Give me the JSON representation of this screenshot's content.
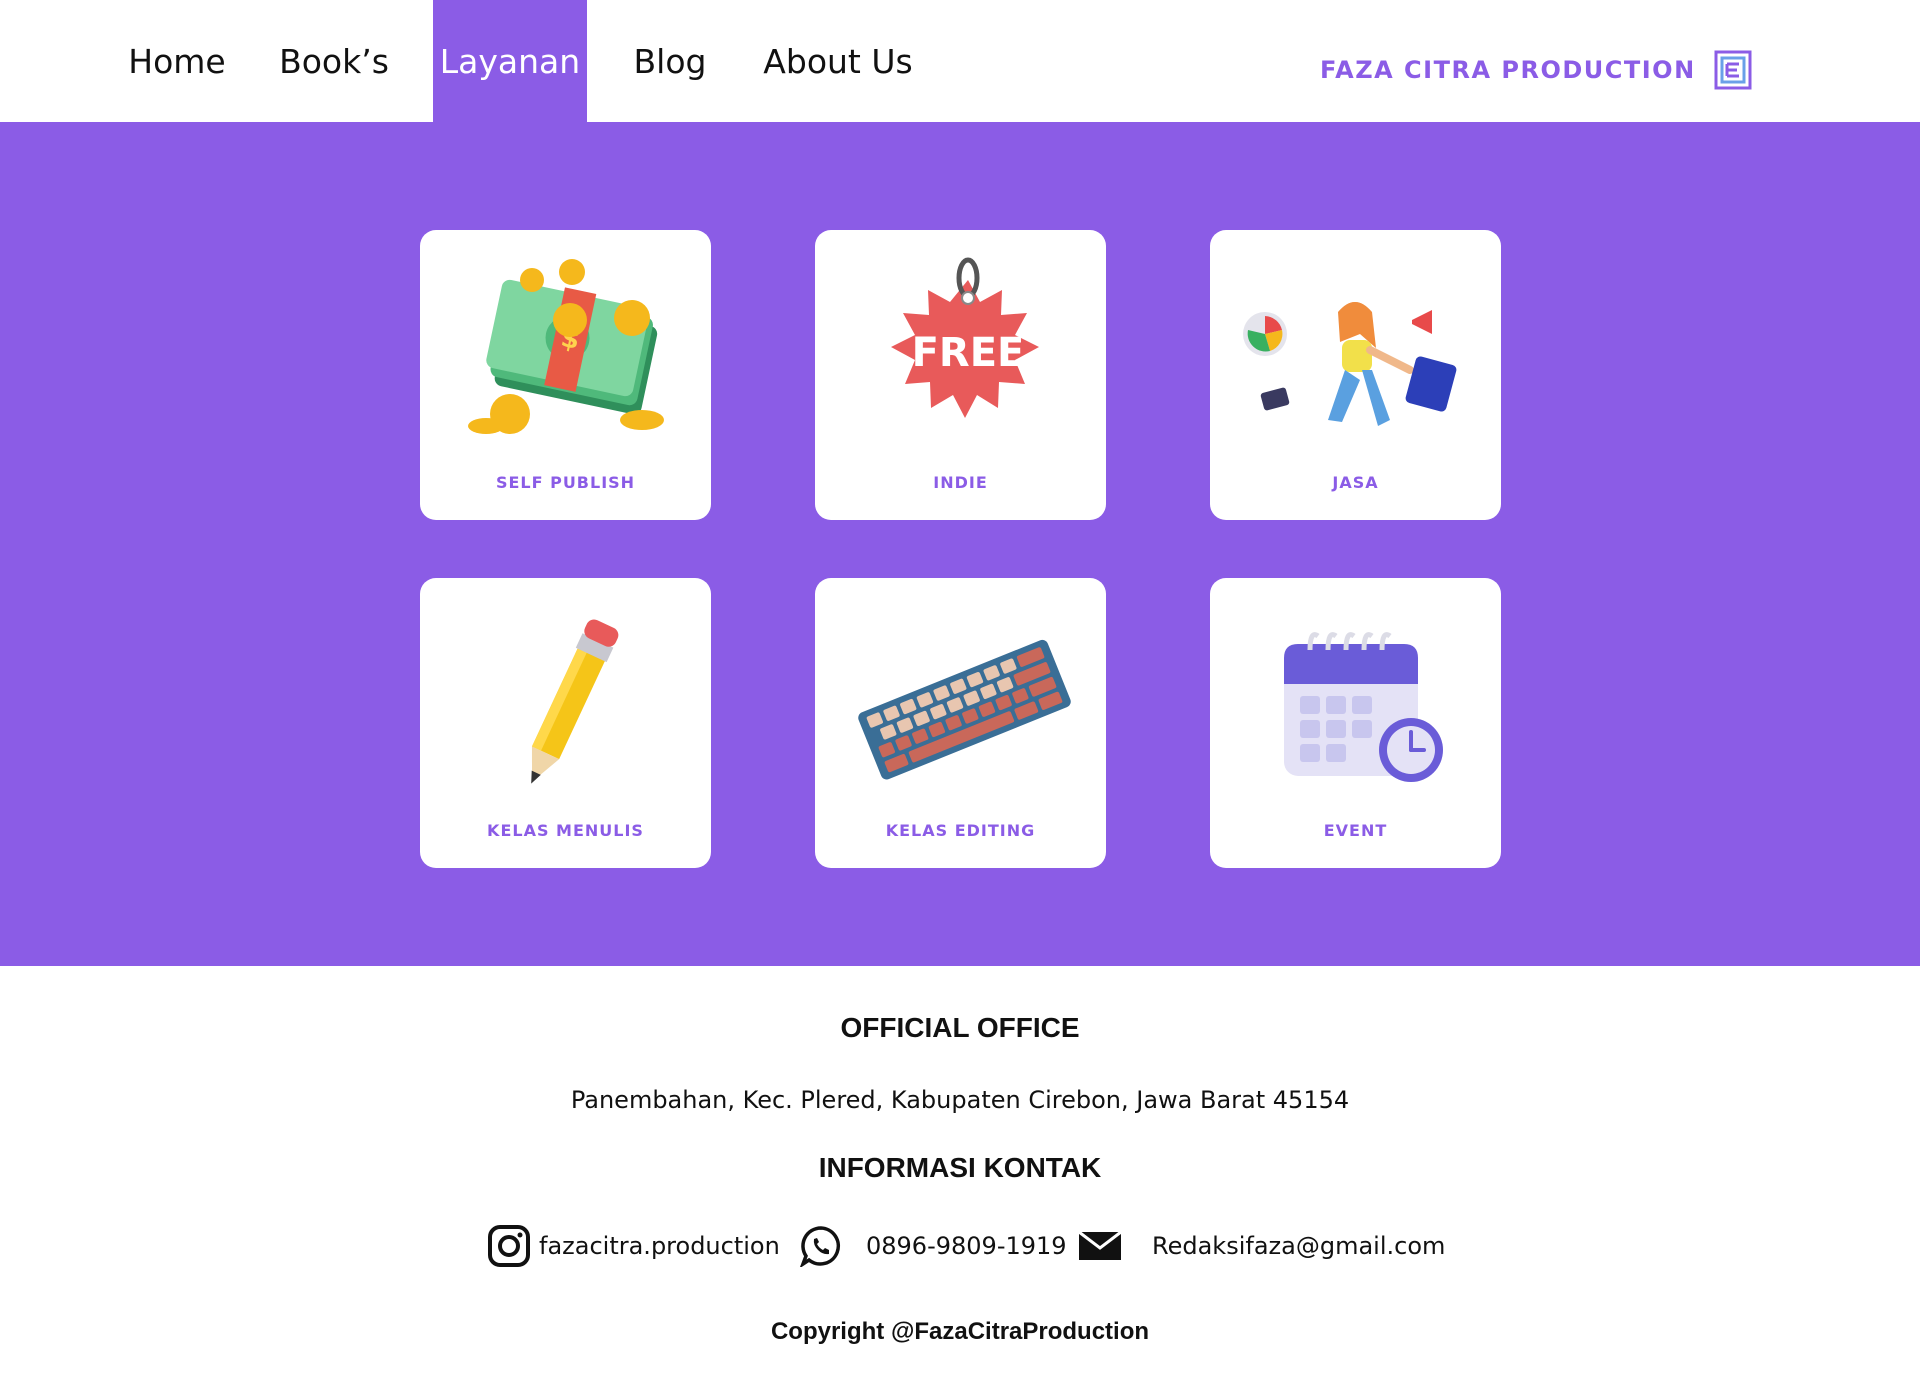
{
  "nav": {
    "items": [
      {
        "label": "Home"
      },
      {
        "label": "Book’s"
      },
      {
        "label": "Layanan",
        "active": true
      },
      {
        "label": "Blog"
      },
      {
        "label": "About Us"
      }
    ],
    "brand": "FAZA CITRA PRODUCTION",
    "brand_icon": "faza-logo-icon"
  },
  "services": [
    {
      "label": "SELF PUBLISH",
      "icon": "money-coins-icon"
    },
    {
      "label": "INDIE",
      "icon": "free-tag-icon"
    },
    {
      "label": "JASA",
      "icon": "business-woman-icon"
    },
    {
      "label": "KELAS MENULIS",
      "icon": "pencil-icon"
    },
    {
      "label": "KELAS EDITING",
      "icon": "keyboard-icon"
    },
    {
      "label": "EVENT",
      "icon": "calendar-clock-icon"
    }
  ],
  "footer": {
    "office_title": "OFFICIAL OFFICE",
    "address": "Panembahan, Kec. Plered, Kabupaten Cirebon, Jawa Barat 45154",
    "contact_title": "INFORMASI KONTAK",
    "instagram": "fazacitra.production",
    "whatsapp": "0896-9809-1919",
    "email": "Redaksifaza@gmail.com",
    "copyright": "Copyright @FazaCitraProduction"
  },
  "colors": {
    "accent": "#8b5ce6",
    "background": "#ffffff",
    "text": "#111111"
  }
}
